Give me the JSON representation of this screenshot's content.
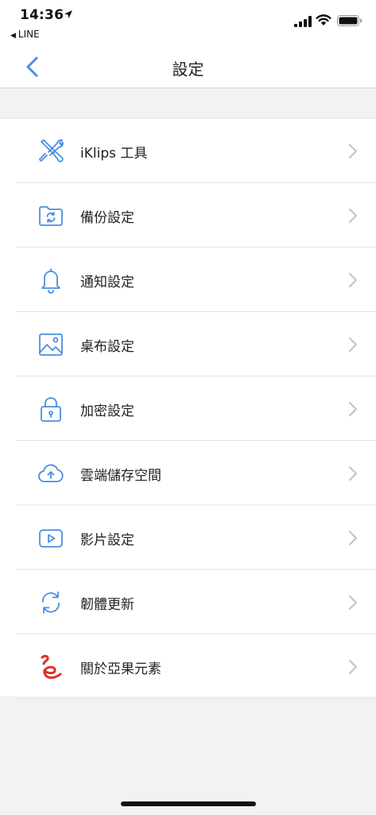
{
  "status_bar": {
    "time": "14:36",
    "back_app": "LINE",
    "back_glyph": "◀"
  },
  "nav": {
    "title": "設定"
  },
  "settings": {
    "items": [
      {
        "label": "iKlips 工具",
        "icon": "tools-icon"
      },
      {
        "label": "備份設定",
        "icon": "backup-folder-icon"
      },
      {
        "label": "通知設定",
        "icon": "bell-icon"
      },
      {
        "label": "桌布設定",
        "icon": "image-icon"
      },
      {
        "label": "加密設定",
        "icon": "lock-icon"
      },
      {
        "label": "雲端儲存空間",
        "icon": "cloud-upload-icon"
      },
      {
        "label": "影片設定",
        "icon": "video-play-icon"
      },
      {
        "label": "韌體更新",
        "icon": "refresh-icon"
      },
      {
        "label": "關於亞果元素",
        "icon": "brand-logo-icon"
      }
    ]
  },
  "colors": {
    "accent": "#4a8fe0",
    "brand_red": "#e1302a",
    "chevron": "#c4c4c9",
    "background": "#f2f2f2"
  }
}
